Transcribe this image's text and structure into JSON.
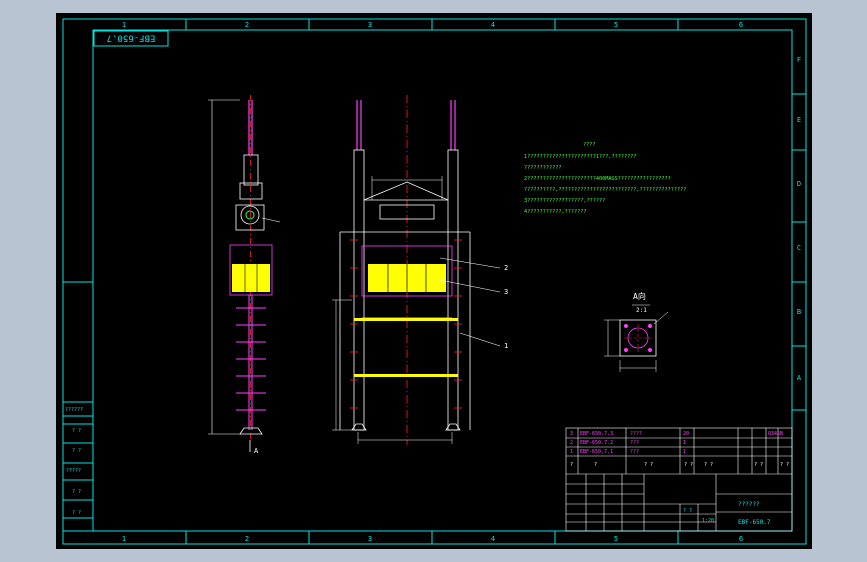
{
  "drawing": {
    "title_block_rotated": "EBF-650.7",
    "zone_numbers": [
      "1",
      "2",
      "3",
      "4",
      "5",
      "6"
    ],
    "zone_letters": [
      "F",
      "E",
      "D",
      "C",
      "B",
      "A"
    ],
    "notes_title": "????",
    "notes": [
      "1??????????????????????1???,????????",
      "  ????????????",
      "2??????????????????????400MAGS?????????????????",
      " ??????????,?????????????????????????,???????????????",
      "3??????????????????,??????",
      "4???????????,???????"
    ],
    "callouts": [
      "2",
      "3",
      "1"
    ],
    "section_label": "A向",
    "section_scale": "2:1",
    "view_arrow_label": "A",
    "left_stamp_labels": [
      "??????",
      "? ?",
      "? ?",
      "?????",
      "? ?",
      "? ?"
    ],
    "parts_rows": [
      {
        "no": "3",
        "code": "EBF-650.7.3",
        "name": "????",
        "qty": "20",
        "note": ""
      },
      {
        "no": "2",
        "code": "EBF-650.7.2",
        "name": "???",
        "qty": "1",
        "note": ""
      },
      {
        "no": "1",
        "code": "EBF-650.7.1",
        "name": "???",
        "qty": "1",
        "note": ""
      }
    ],
    "parts_header": [
      "?",
      "?",
      "? ?",
      "? ?",
      "? ?",
      "? ?",
      "? ?"
    ],
    "material_label": "Q345B",
    "drawing_title": "??????",
    "drawing_number": "EBF-650.7",
    "scale_label": "1:20",
    "sheet_label": "? ?"
  },
  "colors": {
    "background": "#000000",
    "frame": "#00e5e5",
    "outline": "#ffffff",
    "centerline": "#ff2020",
    "yellow": "#ffff00",
    "magenta": "#ff40ff",
    "green": "#40ff40"
  }
}
